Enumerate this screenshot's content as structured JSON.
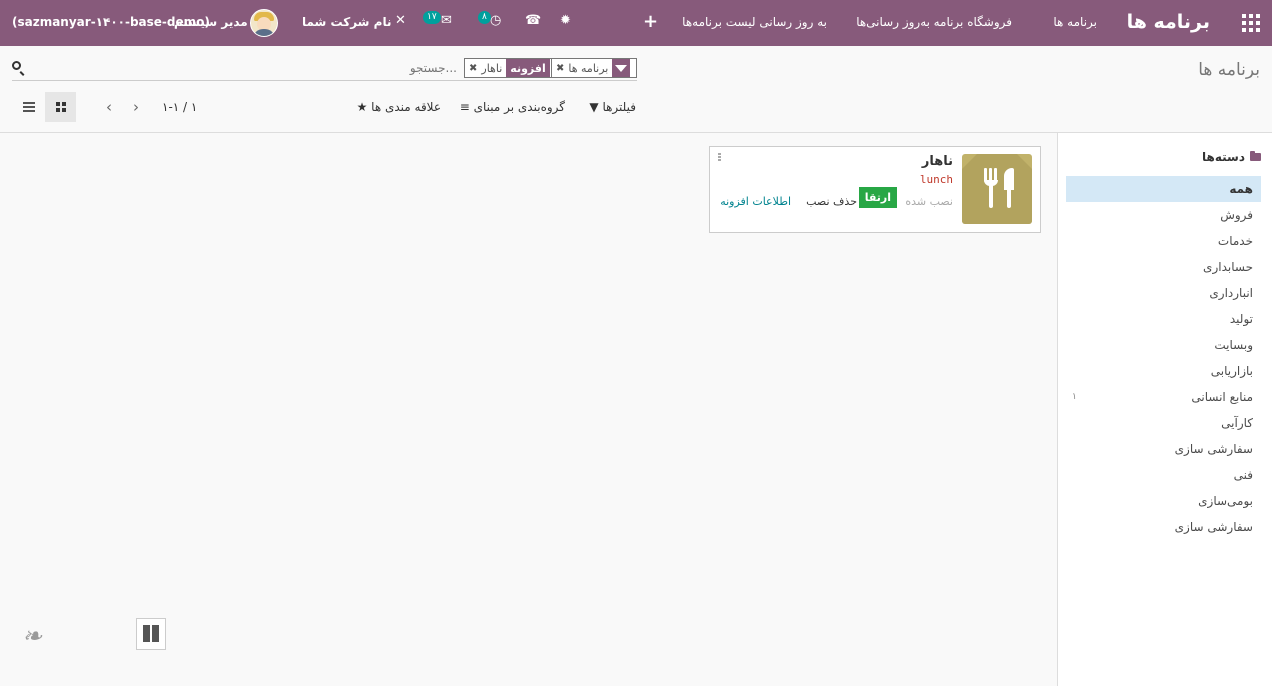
{
  "topbar": {
    "brand": "برنامه ها",
    "menu": [
      "برنامه ها",
      "فروشگاه برنامه",
      "به‌روز رسانی‌ها",
      "به روز رسانی لیست برنامه‌ها"
    ],
    "plus": "+",
    "activity_count": "۸",
    "messages_count": "۱۷",
    "company": "نام شرکت شما",
    "user": "مدیر سیستم",
    "database": "(sazmanyar-۱۴۰۰-base-demo)"
  },
  "breadcrumb": "برنامه ها",
  "search": {
    "facet1_value": "برنامه ها",
    "facet2_label": "افزونه",
    "facet2_value": "ناهار",
    "placeholder": "جستجو..."
  },
  "controls": {
    "filters": "فیلترها",
    "groupby": "گروه‌بندی بر مبنای",
    "favorites": "علاقه مندی ها",
    "pager": "۱-۱ / ۱"
  },
  "sidebar": {
    "title": "دسته‌ها",
    "items": [
      {
        "label": "همه"
      },
      {
        "label": "فروش"
      },
      {
        "label": "خدمات"
      },
      {
        "label": "حسابداری"
      },
      {
        "label": "انبارداری"
      },
      {
        "label": "تولید"
      },
      {
        "label": "وبسایت"
      },
      {
        "label": "بازاریابی"
      },
      {
        "label": "منابع انسانی",
        "count": "۱"
      },
      {
        "label": "کارآیی"
      },
      {
        "label": "سفارشی سازی"
      },
      {
        "label": "فنی"
      },
      {
        "label": "بومی‌سازی"
      },
      {
        "label": "سفارشی سازی"
      }
    ]
  },
  "card": {
    "title": "ناهار",
    "technical_name": "lunch",
    "installed": "نصب شده",
    "upgrade": "ارتقا",
    "uninstall": "حذف نصب",
    "more_info": "اطلاعات افزونه"
  },
  "colors": {
    "brand": "#875a7b",
    "upgrade": "#28a745",
    "accent": "#00a09d"
  }
}
